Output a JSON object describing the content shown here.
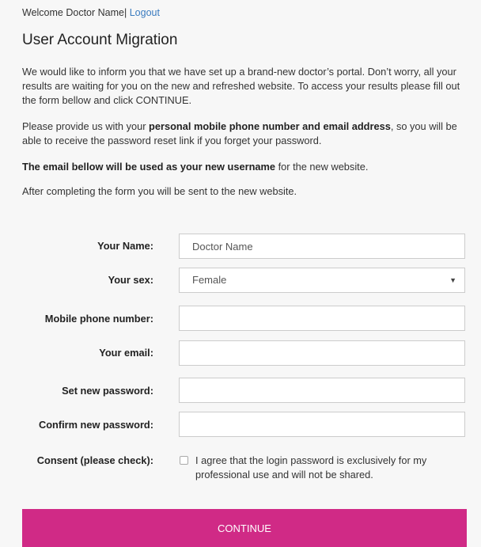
{
  "header": {
    "welcome_text": "Welcome Doctor Name|",
    "logout_label": "Logout"
  },
  "page": {
    "title": "User Account Migration"
  },
  "intro": {
    "p1": "We would like to inform you that we have set up a brand-new doctor’s portal. Don’t worry, all your results are waiting for you on the new and refreshed website. To access your results please fill out the form bellow and click CONTINUE.",
    "p2_prefix": "Please provide us with your ",
    "p2_bold": "personal mobile phone number and email address",
    "p2_suffix": ", so you will be able to receive the password reset link if you forget your password.",
    "p3_bold": "The email bellow will be used as your new username",
    "p3_suffix": " for the new website.",
    "p4": "After completing the form you will be sent to the new website."
  },
  "form": {
    "name_label": "Your Name:",
    "name_value": "Doctor Name",
    "sex_label": "Your sex:",
    "sex_value": "Female",
    "mobile_label": "Mobile phone number:",
    "mobile_value": "",
    "email_label": "Your email:",
    "email_value": "",
    "password_label": "Set new password:",
    "password_value": "",
    "confirm_label": "Confirm new password:",
    "confirm_value": "",
    "consent_label": "Consent (please check):",
    "consent_text": "I agree that the login password is exclusively for my professional use and will not be shared.",
    "consent_checked": false,
    "continue_label": "CONTINUE"
  }
}
